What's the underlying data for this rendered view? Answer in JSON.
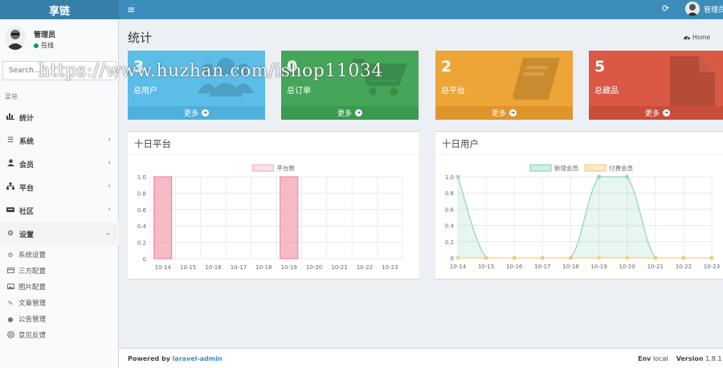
{
  "app": {
    "logo": "享链"
  },
  "navbar": {
    "user_name": "管理员"
  },
  "sidebar": {
    "user": {
      "name": "管理员",
      "status": "在线"
    },
    "search_placeholder": "Search...",
    "menu_header": "菜单",
    "items": [
      {
        "label": "统计",
        "icon": "bar-chart-icon"
      },
      {
        "label": "系统",
        "icon": "list-icon"
      },
      {
        "label": "会员",
        "icon": "user-icon"
      },
      {
        "label": "平台",
        "icon": "sitemap-icon"
      },
      {
        "label": "社区",
        "icon": "keyboard-icon"
      },
      {
        "label": "设置",
        "icon": "gear-icon"
      }
    ],
    "sub_items": [
      {
        "label": "系统设置",
        "icon": "gears-icon"
      },
      {
        "label": "三方配置",
        "icon": "card-icon"
      },
      {
        "label": "图片配置",
        "icon": "image-icon"
      },
      {
        "label": "文章管理",
        "icon": "edit-icon"
      },
      {
        "label": "公告管理",
        "icon": "circle-icon"
      },
      {
        "label": "意见反馈",
        "icon": "lifebuoy-icon"
      }
    ]
  },
  "content": {
    "title": "统计",
    "breadcrumb": "Home"
  },
  "boxes": [
    {
      "value": "3",
      "label": "总用户",
      "footer": "更多",
      "color": "#5bbde8",
      "footer_color": "#4fb0dc",
      "icon": "users-icon"
    },
    {
      "value": "0",
      "label": "总订单",
      "footer": "更多",
      "color": "#45a65a",
      "footer_color": "#3b9a4f",
      "icon": "cart-icon"
    },
    {
      "value": "2",
      "label": "总平台",
      "footer": "更多",
      "color": "#eea538",
      "footer_color": "#de962c",
      "icon": "book-icon"
    },
    {
      "value": "5",
      "label": "总藏品",
      "footer": "更多",
      "color": "#d95945",
      "footer_color": "#c84e3a",
      "icon": "file-icon"
    }
  ],
  "chart_data": [
    {
      "type": "bar",
      "title": "十日平台",
      "categories": [
        "10-14",
        "10-15",
        "10-16",
        "10-17",
        "10-18",
        "10-19",
        "10-20",
        "10-21",
        "10-22",
        "10-23"
      ],
      "series": [
        {
          "name": "平台数",
          "values": [
            1,
            0,
            0,
            0,
            0,
            1,
            0,
            0,
            0,
            0
          ],
          "color": "#f4a9b8"
        }
      ],
      "yticks": [
        "0",
        "0.2",
        "0.4",
        "0.6",
        "0.8",
        "1.0"
      ],
      "ylim": [
        0,
        1
      ],
      "grid": true,
      "legend": "top-center"
    },
    {
      "type": "area",
      "title": "十日用户",
      "categories": [
        "10-14",
        "10-15",
        "10-16",
        "10-17",
        "10-18",
        "10-19",
        "10-20",
        "10-21",
        "10-22",
        "10-23"
      ],
      "series": [
        {
          "name": "新增会员",
          "values": [
            1,
            0,
            0,
            0,
            0,
            1,
            1,
            0,
            0,
            0
          ],
          "color": "#7ccbb7"
        },
        {
          "name": "付费会员",
          "values": [
            0,
            0,
            0,
            0,
            0,
            0,
            0,
            0,
            0,
            0
          ],
          "color": "#f6c66b"
        }
      ],
      "yticks": [
        "0",
        "0.2",
        "0.4",
        "0.6",
        "0.8",
        "1.0"
      ],
      "ylim": [
        0,
        1
      ],
      "grid": true,
      "legend": "top-center"
    }
  ],
  "watermark": "https://www.huzhan.com/ishop11034",
  "footer": {
    "powered_label": "Powered by",
    "powered_link": "laravel-admin",
    "env_label": "Env",
    "env_value": "local",
    "version_label": "Version",
    "version_value": "1.8.1"
  }
}
